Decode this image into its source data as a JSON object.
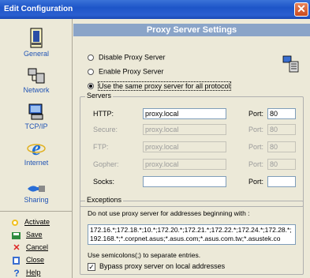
{
  "window": {
    "title": "Edit Configuration",
    "close_icon": "close-icon"
  },
  "sidebar": {
    "items": [
      {
        "label": "General",
        "icon": "general-icon"
      },
      {
        "label": "Network",
        "icon": "network-icon"
      },
      {
        "label": "TCP/IP",
        "icon": "tcpip-icon"
      },
      {
        "label": "Internet",
        "icon": "internet-icon"
      },
      {
        "label": "Sharing",
        "icon": "sharing-icon"
      }
    ],
    "actions": [
      {
        "label": "Activate",
        "icon": "activate-icon"
      },
      {
        "label": "Save",
        "icon": "save-icon"
      },
      {
        "label": "Cancel",
        "icon": "cancel-icon"
      },
      {
        "label": "Close",
        "icon": "close-doc-icon"
      },
      {
        "label": "Help",
        "icon": "help-icon"
      }
    ]
  },
  "main": {
    "header": "Proxy Server Settings",
    "radios": [
      {
        "label": "Disable Proxy Server",
        "selected": false
      },
      {
        "label": "Enable Proxy Server",
        "selected": false
      },
      {
        "label": "Use the same proxy server for all protocol",
        "selected": true
      }
    ],
    "servers": {
      "title": "Servers",
      "rows": [
        {
          "label": "HTTP:",
          "value": "proxy.local",
          "port_label": "Port:",
          "port": "80",
          "enabled": true
        },
        {
          "label": "Secure:",
          "value": "proxy.local",
          "port_label": "Port:",
          "port": "80",
          "enabled": false
        },
        {
          "label": "FTP:",
          "value": "proxy.local",
          "port_label": "Port:",
          "port": "80",
          "enabled": false
        },
        {
          "label": "Gopher:",
          "value": "proxy.local",
          "port_label": "Port:",
          "port": "80",
          "enabled": false
        },
        {
          "label": "Socks:",
          "value": "",
          "port_label": "Port:",
          "port": "",
          "enabled": true
        }
      ]
    },
    "exceptions": {
      "title": "Exceptions",
      "description": "Do not use proxy server for addresses beginning with :",
      "value": "172.16.*;172.18.*;10.*;172.20.*;172.21.*;172.22.*;172.24.*;172.28.*;192.168.*;*.corpnet.asus;*.asus.com;*.asus.com.tw;*.asustek.co",
      "hint": "Use semicolons(;) to separate entries.",
      "bypass_label": "Bypass proxy server on local addresses",
      "bypass_checked": true
    }
  }
}
